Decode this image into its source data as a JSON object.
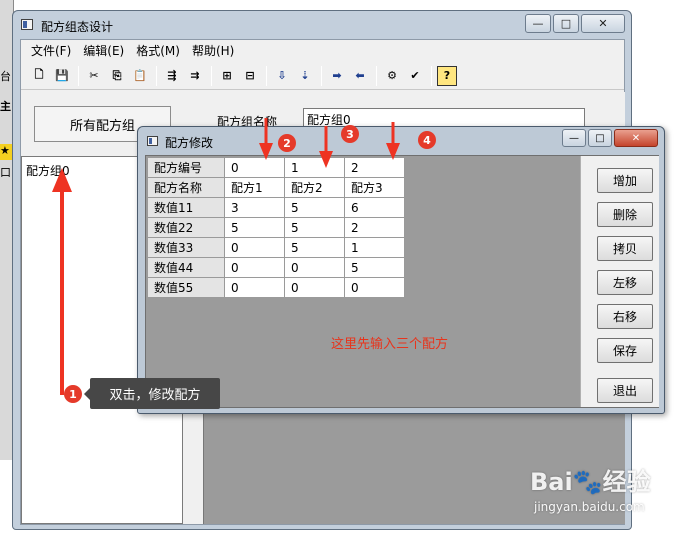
{
  "background": {
    "left_fragments": [
      "台",
      "主持",
      "口"
    ]
  },
  "window": {
    "title": "配方组态设计",
    "controls": {
      "minimize": "—",
      "maximize": "□",
      "close": "✕"
    }
  },
  "menu": [
    "文件(F)",
    "编辑(E)",
    "格式(M)",
    "帮助(H)"
  ],
  "toolbar": {
    "icons": [
      "new-icon",
      "save-icon",
      "cut-icon",
      "copy-icon",
      "paste-icon",
      "insert-column-icon",
      "append-column-icon",
      "left-align-icon",
      "right-align-icon",
      "download-icon",
      "upload-icon",
      "move-right-icon",
      "move-left-icon",
      "properties-icon",
      "check-icon",
      "help-icon"
    ],
    "glyphs": [
      "🗋",
      "💾",
      "✂",
      "⎘",
      "📋",
      "⇶",
      "⇉",
      "⊞",
      "⊟",
      "⇩",
      "⇣",
      "➡",
      "⬅",
      "⚙",
      "✔",
      "?"
    ]
  },
  "left_panel": {
    "group_button": "所有配方组",
    "tree_item": "配方组0"
  },
  "group_name": {
    "label": "配方组名称",
    "value": "配方组0"
  },
  "dialog": {
    "title": "配方修改",
    "controls": {
      "minimize": "—",
      "maximize": "□",
      "close": "✕"
    },
    "rows": [
      {
        "label": "配方编号",
        "cells": [
          "0",
          "1",
          "2"
        ]
      },
      {
        "label": "配方名称",
        "cells": [
          "配方1",
          "配方2",
          "配方3"
        ]
      },
      {
        "label": "数值11",
        "cells": [
          "3",
          "5",
          "6"
        ]
      },
      {
        "label": "数值22",
        "cells": [
          "5",
          "5",
          "2"
        ]
      },
      {
        "label": "数值33",
        "cells": [
          "0",
          "5",
          "1"
        ]
      },
      {
        "label": "数值44",
        "cells": [
          "0",
          "0",
          "5"
        ]
      },
      {
        "label": "数值55",
        "cells": [
          "0",
          "0",
          "0"
        ]
      }
    ],
    "buttons": {
      "add": "增加",
      "delete": "删除",
      "copy": "拷贝",
      "move_left": "左移",
      "move_right": "右移",
      "save": "保存",
      "exit": "退出"
    },
    "hint": "这里先输入三个配方"
  },
  "annotations": {
    "badges": [
      "1",
      "2",
      "3",
      "4"
    ],
    "tooltip": "双击，修改配方",
    "color": "#ee3322"
  },
  "watermark": {
    "main": "Bai🐾经验",
    "sub": "jingyan.baidu.com"
  }
}
